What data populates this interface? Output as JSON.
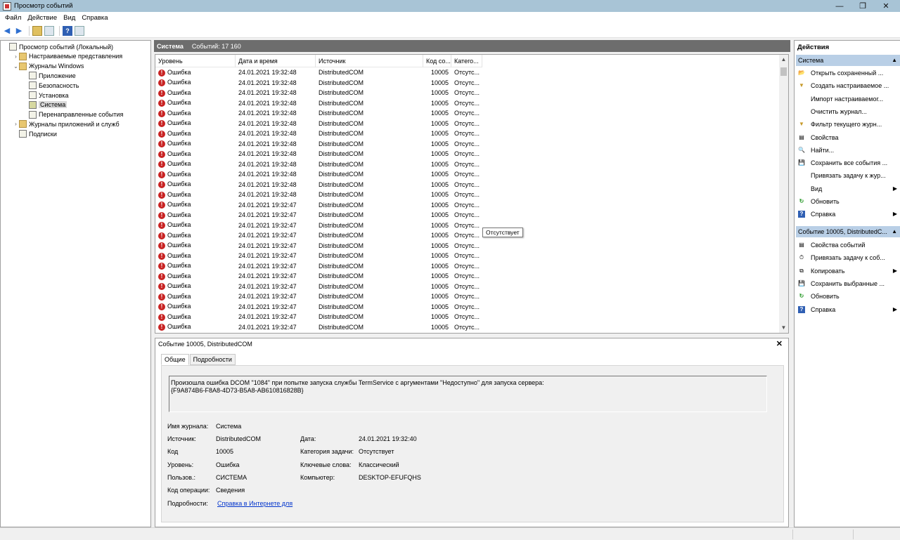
{
  "window": {
    "title": "Просмотр событий",
    "minimize": "—",
    "maximize": "❐",
    "close": "✕"
  },
  "menu": [
    "Файл",
    "Действие",
    "Вид",
    "Справка"
  ],
  "tree": [
    {
      "label": "Просмотр событий (Локальный)",
      "level": 0,
      "expander": "",
      "icon": "computer-icon"
    },
    {
      "label": "Настраиваемые представления",
      "level": 1,
      "expander": "›",
      "icon": "folder-icon"
    },
    {
      "label": "Журналы Windows",
      "level": 1,
      "expander": "⌄",
      "icon": "folder-icon"
    },
    {
      "label": "Приложение",
      "level": 2,
      "expander": "",
      "icon": "log-icon"
    },
    {
      "label": "Безопасность",
      "level": 2,
      "expander": "",
      "icon": "log-icon"
    },
    {
      "label": "Установка",
      "level": 2,
      "expander": "",
      "icon": "log-icon"
    },
    {
      "label": "Система",
      "level": 2,
      "expander": "",
      "icon": "log-icon",
      "selected": true
    },
    {
      "label": "Перенаправленные события",
      "level": 2,
      "expander": "",
      "icon": "log-icon"
    },
    {
      "label": "Журналы приложений и служб",
      "level": 1,
      "expander": "›",
      "icon": "folder-icon"
    },
    {
      "label": "Подписки",
      "level": 1,
      "expander": "",
      "icon": "log-icon"
    }
  ],
  "list": {
    "title": "Система",
    "count": "Событий: 17 160",
    "columns": [
      "Уровень",
      "Дата и время",
      "Источник",
      "Код со...",
      "Катего..."
    ],
    "rows": [
      [
        "Ошибка",
        "24.01.2021 19:32:48",
        "DistributedCOM",
        "10005",
        "Отсутс..."
      ],
      [
        "Ошибка",
        "24.01.2021 19:32:48",
        "DistributedCOM",
        "10005",
        "Отсутс..."
      ],
      [
        "Ошибка",
        "24.01.2021 19:32:48",
        "DistributedCOM",
        "10005",
        "Отсутс..."
      ],
      [
        "Ошибка",
        "24.01.2021 19:32:48",
        "DistributedCOM",
        "10005",
        "Отсутс..."
      ],
      [
        "Ошибка",
        "24.01.2021 19:32:48",
        "DistributedCOM",
        "10005",
        "Отсутс..."
      ],
      [
        "Ошибка",
        "24.01.2021 19:32:48",
        "DistributedCOM",
        "10005",
        "Отсутс..."
      ],
      [
        "Ошибка",
        "24.01.2021 19:32:48",
        "DistributedCOM",
        "10005",
        "Отсутс..."
      ],
      [
        "Ошибка",
        "24.01.2021 19:32:48",
        "DistributedCOM",
        "10005",
        "Отсутс..."
      ],
      [
        "Ошибка",
        "24.01.2021 19:32:48",
        "DistributedCOM",
        "10005",
        "Отсутс..."
      ],
      [
        "Ошибка",
        "24.01.2021 19:32:48",
        "DistributedCOM",
        "10005",
        "Отсутс..."
      ],
      [
        "Ошибка",
        "24.01.2021 19:32:48",
        "DistributedCOM",
        "10005",
        "Отсутс..."
      ],
      [
        "Ошибка",
        "24.01.2021 19:32:48",
        "DistributedCOM",
        "10005",
        "Отсутс..."
      ],
      [
        "Ошибка",
        "24.01.2021 19:32:48",
        "DistributedCOM",
        "10005",
        "Отсутс..."
      ],
      [
        "Ошибка",
        "24.01.2021 19:32:47",
        "DistributedCOM",
        "10005",
        "Отсутс..."
      ],
      [
        "Ошибка",
        "24.01.2021 19:32:47",
        "DistributedCOM",
        "10005",
        "Отсутс..."
      ],
      [
        "Ошибка",
        "24.01.2021 19:32:47",
        "DistributedCOM",
        "10005",
        "Отсутс..."
      ],
      [
        "Ошибка",
        "24.01.2021 19:32:47",
        "DistributedCOM",
        "10005",
        "Отсутс..."
      ],
      [
        "Ошибка",
        "24.01.2021 19:32:47",
        "DistributedCOM",
        "10005",
        "Отсутс..."
      ],
      [
        "Ошибка",
        "24.01.2021 19:32:47",
        "DistributedCOM",
        "10005",
        "Отсутс..."
      ],
      [
        "Ошибка",
        "24.01.2021 19:32:47",
        "DistributedCOM",
        "10005",
        "Отсутс..."
      ],
      [
        "Ошибка",
        "24.01.2021 19:32:47",
        "DistributedCOM",
        "10005",
        "Отсутс..."
      ],
      [
        "Ошибка",
        "24.01.2021 19:32:47",
        "DistributedCOM",
        "10005",
        "Отсутс..."
      ],
      [
        "Ошибка",
        "24.01.2021 19:32:47",
        "DistributedCOM",
        "10005",
        "Отсутс..."
      ],
      [
        "Ошибка",
        "24.01.2021 19:32:47",
        "DistributedCOM",
        "10005",
        "Отсутс..."
      ],
      [
        "Ошибка",
        "24.01.2021 19:32:47",
        "DistributedCOM",
        "10005",
        "Отсутс..."
      ],
      [
        "Ошибка",
        "24.01.2021 19:32:47",
        "DistributedCOM",
        "10005",
        "Отсутс..."
      ],
      [
        "Ошибка",
        "24.01.2021 19:32:47",
        "DistributedCOM",
        "10005",
        "Отсутс..."
      ]
    ],
    "tooltip": "Отсутствует"
  },
  "detail": {
    "title": "Событие 10005, DistributedCOM",
    "tabs": [
      "Общие",
      "Подробности"
    ],
    "message_line1": "Произошла ошибка DCOM \"1084\" при попытке запуска службы TermService с аргументами \"Недоступно\" для запуска сервера:",
    "message_line2": "{F9A874B6-F8A8-4D73-B5A8-AB610816828B}",
    "labels": {
      "log_name": "Имя журнала:",
      "source": "Источник:",
      "code": "Код",
      "level": "Уровень:",
      "user": "Пользов.:",
      "opcode": "Код операции:",
      "more": "Подробности:",
      "date": "Дата:",
      "task": "Категория задачи:",
      "keywords": "Ключевые слова:",
      "computer": "Компьютер:"
    },
    "values": {
      "log_name": "Система",
      "source": "DistributedCOM",
      "code": "10005",
      "level": "Ошибка",
      "user": "СИСТЕМА",
      "opcode": "Сведения",
      "more": "Справка в Интернете для",
      "date": "24.01.2021 19:32:40",
      "task": "Отсутствует",
      "keywords": "Классический",
      "computer": "DESKTOP-EFUFQHS"
    }
  },
  "actions": {
    "title": "Действия",
    "section1": {
      "label": "Система",
      "items": [
        {
          "label": "Открыть сохраненный ...",
          "icon": "open-icon",
          "glyph": "📂",
          "submenu": false
        },
        {
          "label": "Создать настраиваемое ...",
          "icon": "filter-icon",
          "glyph": "▼",
          "submenu": false
        },
        {
          "label": "Импорт настраиваемог...",
          "icon": "",
          "glyph": "",
          "submenu": false
        },
        {
          "label": "Очистить журнал...",
          "icon": "",
          "glyph": "",
          "submenu": false
        },
        {
          "label": "Фильтр текущего журн...",
          "icon": "filter-icon",
          "glyph": "▼",
          "submenu": false
        },
        {
          "label": "Свойства",
          "icon": "properties-icon",
          "glyph": "▤",
          "submenu": false
        },
        {
          "label": "Найти...",
          "icon": "find-icon",
          "glyph": "🔍",
          "submenu": false
        },
        {
          "label": "Сохранить все события ...",
          "icon": "save-icon",
          "glyph": "💾",
          "submenu": false
        },
        {
          "label": "Привязать задачу к жур...",
          "icon": "",
          "glyph": "",
          "submenu": false
        },
        {
          "label": "Вид",
          "icon": "",
          "glyph": "",
          "submenu": true
        },
        {
          "label": "Обновить",
          "icon": "refresh-icon",
          "glyph": "↻",
          "submenu": false
        },
        {
          "label": "Справка",
          "icon": "help-icon",
          "glyph": "?",
          "submenu": true
        }
      ]
    },
    "section2": {
      "label": "Событие 10005, DistributedC...",
      "items": [
        {
          "label": "Свойства событий",
          "icon": "properties-icon",
          "glyph": "▤",
          "submenu": false
        },
        {
          "label": "Привязать задачу к соб...",
          "icon": "task-icon",
          "glyph": "⏱",
          "submenu": false
        },
        {
          "label": "Копировать",
          "icon": "copy-icon",
          "glyph": "⧉",
          "submenu": true
        },
        {
          "label": "Сохранить выбранные ...",
          "icon": "save-icon",
          "glyph": "💾",
          "submenu": false
        },
        {
          "label": "Обновить",
          "icon": "refresh-icon",
          "glyph": "↻",
          "submenu": false
        },
        {
          "label": "Справка",
          "icon": "help-icon",
          "glyph": "?",
          "submenu": true
        }
      ]
    },
    "collapse_arrow": "▲",
    "submenu_arrow": "▶"
  },
  "colors": {
    "error": "#c82323",
    "section": "#b9cfe6",
    "header": "#6d6d6d",
    "title": "#a8c4d6"
  }
}
